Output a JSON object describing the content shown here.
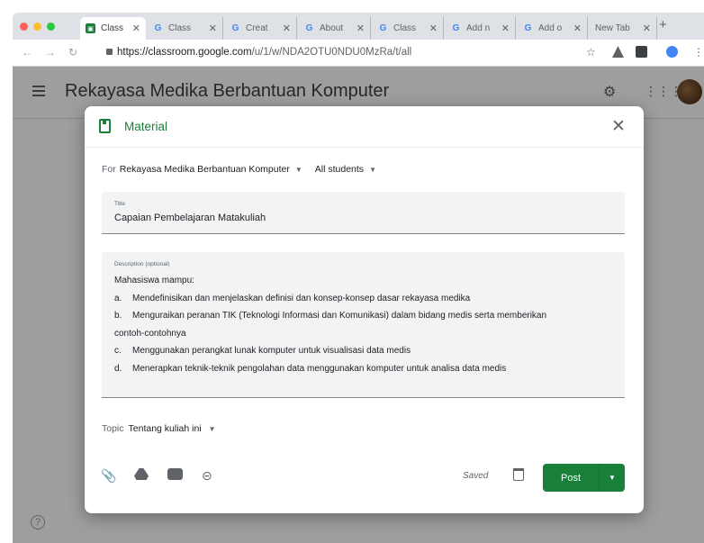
{
  "browser": {
    "tabs": [
      {
        "title": "Class",
        "favicon": "classroom-icon",
        "active": true
      },
      {
        "title": "Class",
        "favicon": "google-icon"
      },
      {
        "title": "Creat",
        "favicon": "google-icon"
      },
      {
        "title": "About",
        "favicon": "google-icon"
      },
      {
        "title": "Class",
        "favicon": "google-icon"
      },
      {
        "title": "Add n",
        "favicon": "google-icon"
      },
      {
        "title": "Add o",
        "favicon": "google-icon"
      },
      {
        "title": "New Tab",
        "favicon": ""
      }
    ],
    "url_host": "https://classroom.google.com",
    "url_path": "/u/1/w/NDA2OTU0NDU0MzRa/t/all"
  },
  "page": {
    "course_title": "Rekayasa Medika Berbantuan Komputer"
  },
  "dialog": {
    "title": "Material",
    "for_label": "For",
    "class_value": "Rekayasa Medika Berbantuan Komputer",
    "students_value": "All students",
    "title_label": "Title",
    "title_value": "Capaian Pembelajaran Matakuliah",
    "description_label": "Description (optional)",
    "description_intro": "Mahasiswa mampu:",
    "description_items": [
      {
        "marker": "a.",
        "text": "Mendefinisikan dan menjelaskan definisi dan konsep-konsep dasar rekayasa medika"
      },
      {
        "marker": "b.",
        "text": "Menguraikan peranan TIK (Teknologi Informasi dan Komunikasi) dalam bidang medis serta memberikan"
      },
      {
        "marker": "",
        "text": "contoh-contohnya"
      },
      {
        "marker": "c.",
        "text": "Menggunakan perangkat lunak komputer untuk visualisasi data medis"
      },
      {
        "marker": "d.",
        "text": "Menerapkan teknik-teknik pengolahan data menggunakan komputer untuk analisa data medis"
      }
    ],
    "topic_label": "Topic",
    "topic_value": "Tentang kuliah ini",
    "saved_text": "Saved",
    "post_label": "Post"
  },
  "colors": {
    "accent": "#188038",
    "scrim": "rgba(0,0,0,0.38)"
  }
}
